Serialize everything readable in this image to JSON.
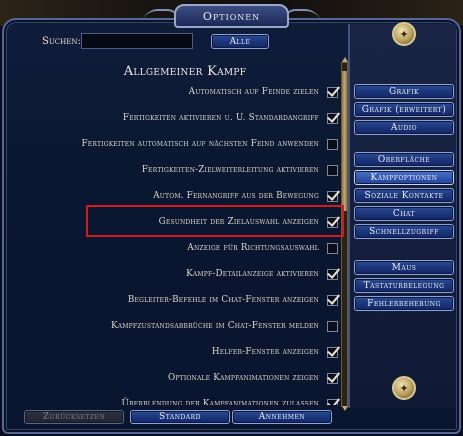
{
  "window": {
    "title": "Optionen"
  },
  "search": {
    "label": "Suchen:",
    "value": "",
    "all_button": "Alle"
  },
  "section": {
    "title": "Allgemeiner Kampf"
  },
  "options": [
    {
      "label": "Automatisch auf Feinde zielen",
      "checked": true
    },
    {
      "label": "Fertigkeiten aktivieren u. U. Standardangriff",
      "checked": true
    },
    {
      "label": "Fertigkeiten automatisch auf nächsten Feind anwenden",
      "checked": false
    },
    {
      "label": "Fertigkeiten-Zielweiterleitung aktivieren",
      "checked": false
    },
    {
      "label": "Autom. Fernangriff aus der Bewegung",
      "checked": true
    },
    {
      "label": "Gesundheit der Zielauswahl anzeigen",
      "checked": true
    },
    {
      "label": "Anzeige für Richtungsauswahl",
      "checked": false
    },
    {
      "label": "Kampf-Detailanzeige aktivieren",
      "checked": true
    },
    {
      "label": "Begleiter-Befehle im Chat-Fenster anzeigen",
      "checked": true
    },
    {
      "label": "Kampfzustandsabbrüche im Chat-Fenster melden",
      "checked": false
    },
    {
      "label": "Helfer-Fenster anzeigen",
      "checked": true
    },
    {
      "label": "Optionale Kampfanimationen zeigen",
      "checked": true
    },
    {
      "label": "Überblendung der Kampfanimationen zulassen",
      "checked": true
    }
  ],
  "side_nav": {
    "group1": [
      "Grafik",
      "Grafik (erweitert)",
      "Audio"
    ],
    "group2": [
      "Oberfläche",
      "Kampfoptionen",
      "Soziale Kontakte",
      "Chat",
      "Schnellzugriff"
    ],
    "group3": [
      "Maus",
      "Tastaturbelegung",
      "Fehlerbehebung"
    ],
    "active": "Kampfoptionen"
  },
  "footer": {
    "reset": "Zurücksetzen",
    "standard": "Standard",
    "accept": "Annehmen"
  }
}
